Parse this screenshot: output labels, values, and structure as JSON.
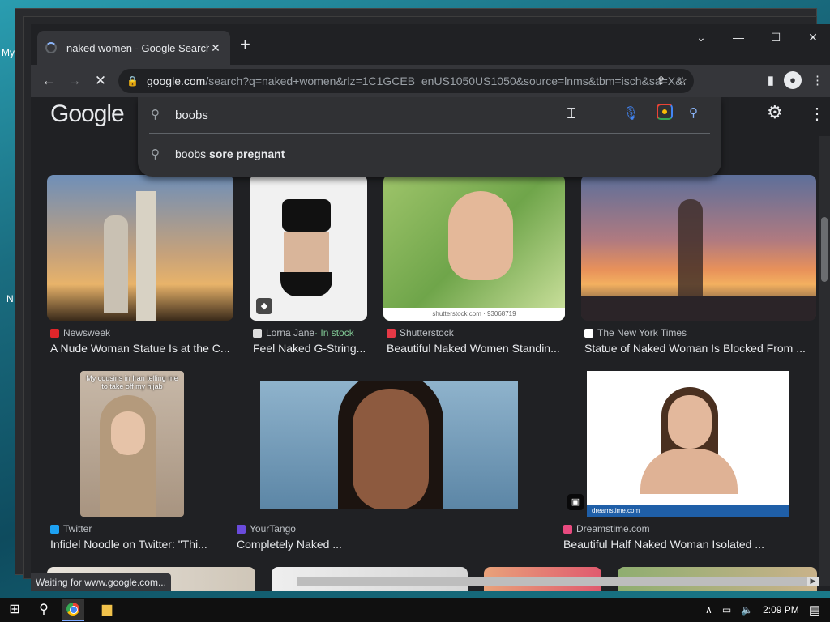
{
  "desktop": {
    "labels": [
      "My",
      "N"
    ]
  },
  "browser": {
    "tab_title": "naked women - Google Search",
    "tab_close": "✕",
    "new_tab": "+",
    "controls": {
      "dropdown": "⌄",
      "minimize": "—",
      "maximize": "☐",
      "close": "✕"
    },
    "url_host": "google.com",
    "url_path": "/search?q=naked+women&rlz=1C1GCEB_enUS1050US1050&source=lnms&tbm=isch&sa=X&...",
    "status_text": "Waiting for www.google.com..."
  },
  "google": {
    "logo": "Google",
    "search_value": "boobs",
    "suggestion_prefix": "boobs",
    "suggestion_rest": " sore pregnant"
  },
  "results": [
    {
      "source": "Newsweek",
      "title": "A Nude Woman Statue Is at the C...",
      "fav_color": "#e0262a"
    },
    {
      "source": "Lorna Jane",
      "stock": " · In stock",
      "title": "Feel Naked G-String...",
      "fav_color": "#dddddd"
    },
    {
      "source": "Shutterstock",
      "title": "Beautiful Naked Women Standin...",
      "fav_color": "#e63946"
    },
    {
      "source": "The New York Times",
      "title": "Statue of Naked Woman Is Blocked From ...",
      "fav_color": "#ffffff"
    },
    {
      "source": "Twitter",
      "title": "Infidel Noodle on Twitter: \"Thi...",
      "fav_color": "#1da1f2"
    },
    {
      "source": "YourTango",
      "title": "Completely Naked ...",
      "fav_color": "#6a4bdc"
    },
    {
      "source": "Dreamstime.com",
      "title": "Beautiful Half Naked Woman Isolated ...",
      "fav_color": "#e84a7f"
    }
  ],
  "image_captions": {
    "tiktok": "My cousins in Iran telling me to take off my hijab",
    "shutter_wm": "shutterstock.com · 93068719",
    "dreamstime_wm": "dreamstime.com"
  },
  "taskbar": {
    "time": "2:09 PM"
  }
}
